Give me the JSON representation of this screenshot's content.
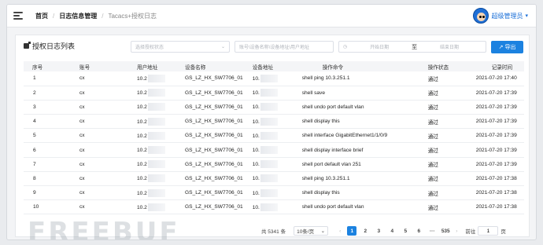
{
  "breadcrumb": [
    "首页",
    "日志信息管理",
    "Tacacs+授权日志"
  ],
  "user": {
    "name": "超级管理员"
  },
  "card": {
    "title": "授权日志列表",
    "status_placeholder": "选择授权状态",
    "search_placeholder": "账号\\设备名称\\设备地址\\用户地址",
    "start_placeholder": "开始日期",
    "date_to": "至",
    "end_placeholder": "结束日期",
    "export_label": "导出"
  },
  "table": {
    "headers": [
      "序号",
      "账号",
      "用户地址",
      "设备名称",
      "设备地址",
      "操作命令",
      "操作状态",
      "记录时间"
    ],
    "rows": [
      [
        "1",
        "cx",
        "10.2",
        "GS_LZ_HX_SW7706_01",
        "10.",
        "shell ping 10.3.251.1",
        "通过",
        "2021-07-20 17:40"
      ],
      [
        "2",
        "cx",
        "10.2",
        "GS_LZ_HX_SW7706_01",
        "10.",
        "shell save",
        "通过",
        "2021-07-20 17:39"
      ],
      [
        "3",
        "cx",
        "10.2",
        "GS_LZ_HX_SW7706_01",
        "10.",
        "shell undo port default vlan",
        "通过",
        "2021-07-20 17:39"
      ],
      [
        "4",
        "cx",
        "10.2",
        "GS_LZ_HX_SW7706_01",
        "10.",
        "shell display this",
        "通过",
        "2021-07-20 17:39"
      ],
      [
        "5",
        "cx",
        "10.2",
        "GS_LZ_HX_SW7706_01",
        "10.",
        "shell interface GigabitEthernet1/1/0/9",
        "通过",
        "2021-07-20 17:39"
      ],
      [
        "6",
        "cx",
        "10.2",
        "GS_LZ_HX_SW7706_01",
        "10.",
        "shell display interface brief",
        "通过",
        "2021-07-20 17:39"
      ],
      [
        "7",
        "cx",
        "10.2",
        "GS_LZ_HX_SW7706_01",
        "10.",
        "shell port default vlan 251",
        "通过",
        "2021-07-20 17:39"
      ],
      [
        "8",
        "cx",
        "10.2",
        "GS_LZ_HX_SW7706_01",
        "10.",
        "shell ping 10.3.251.1",
        "通过",
        "2021-07-20 17:38"
      ],
      [
        "9",
        "cx",
        "10.2",
        "GS_LZ_HX_SW7706_01",
        "10.",
        "shell display this",
        "通过",
        "2021-07-20 17:38"
      ],
      [
        "10",
        "cx",
        "10.2",
        "GS_LZ_HX_SW7706_01",
        "10.",
        "shell undo port default vlan",
        "通过",
        "2021-07-20 17:38"
      ]
    ]
  },
  "pagination": {
    "total": "共 5341 条",
    "page_size": "10条/页",
    "pages": [
      "1",
      "2",
      "3",
      "4",
      "5",
      "6",
      "···",
      "535"
    ],
    "active_page": "1",
    "goto_label": "前往",
    "goto_value": "1",
    "page_unit": "页"
  },
  "watermark": "FREEBUF"
}
